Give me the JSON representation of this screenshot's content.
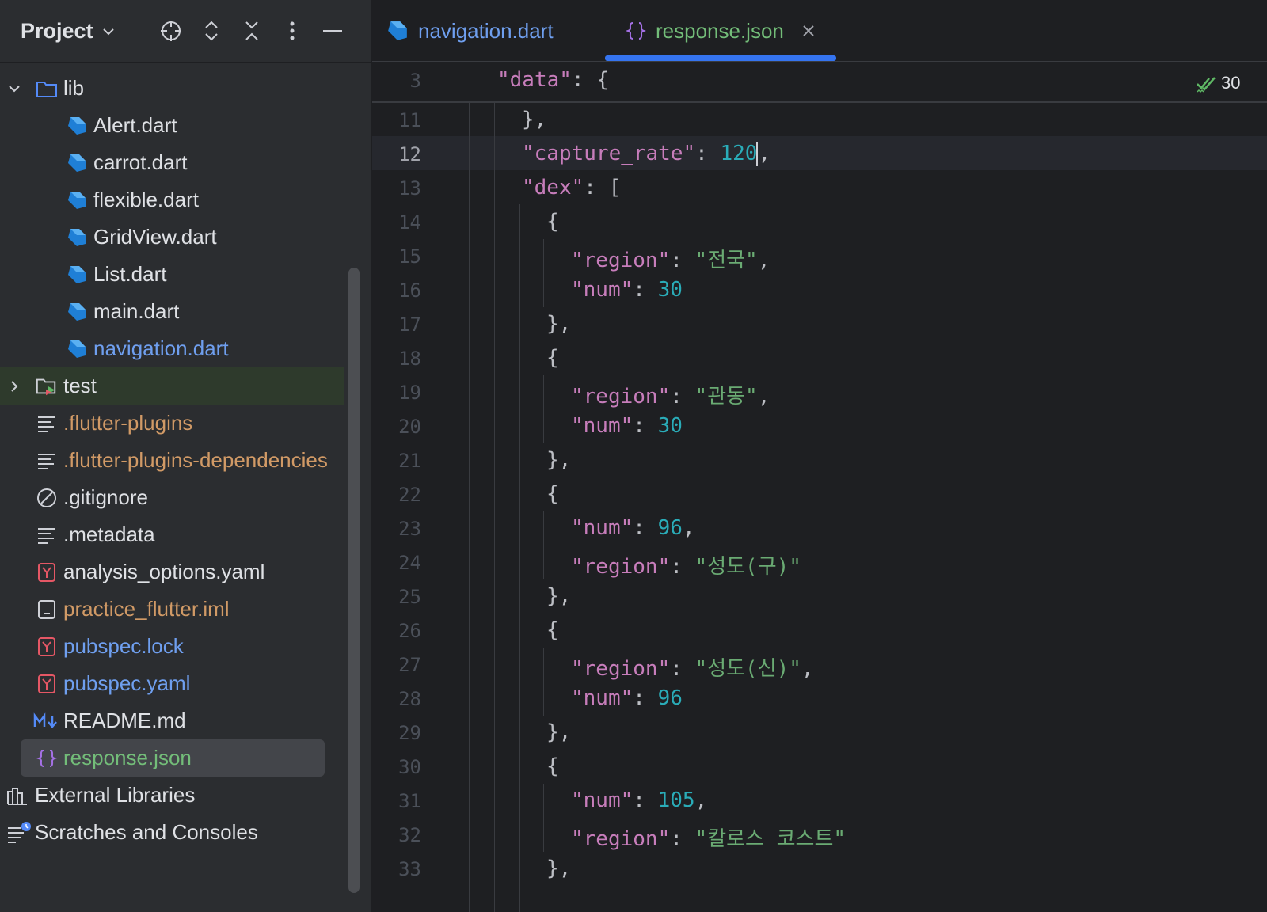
{
  "project_panel": {
    "title": "Project",
    "header_icons": [
      "locate-icon",
      "expand-all-icon",
      "collapse-all-icon",
      "more-options-icon",
      "hide-panel-icon"
    ],
    "tree": {
      "lib": "lib",
      "lib_files": [
        "Alert.dart",
        "carrot.dart",
        "flexible.dart",
        "GridView.dart",
        "List.dart",
        "main.dart",
        "navigation.dart"
      ],
      "test": "test",
      "root_files": [
        ".flutter-plugins",
        ".flutter-plugins-dependencies",
        ".gitignore",
        ".metadata",
        "analysis_options.yaml",
        "practice_flutter.iml",
        "pubspec.lock",
        "pubspec.yaml",
        "README.md",
        "response.json"
      ],
      "external_libraries": "External Libraries",
      "scratches": "Scratches and Consoles"
    }
  },
  "tabs": [
    {
      "label": "navigation.dart",
      "active": false
    },
    {
      "label": "response.json",
      "active": true
    }
  ],
  "editor": {
    "inspection_count": "30",
    "sticky": {
      "line": "3",
      "key": "\"data\"",
      "rest": ": {"
    },
    "lines": [
      {
        "num": "11",
        "current": false
      },
      {
        "num": "12",
        "current": true
      },
      {
        "num": "13",
        "current": false
      },
      {
        "num": "14",
        "current": false
      },
      {
        "num": "15",
        "current": false
      },
      {
        "num": "16",
        "current": false
      },
      {
        "num": "17",
        "current": false
      },
      {
        "num": "18",
        "current": false
      },
      {
        "num": "19",
        "current": false
      },
      {
        "num": "20",
        "current": false
      },
      {
        "num": "21",
        "current": false
      },
      {
        "num": "22",
        "current": false
      },
      {
        "num": "23",
        "current": false
      },
      {
        "num": "24",
        "current": false
      },
      {
        "num": "25",
        "current": false
      },
      {
        "num": "26",
        "current": false
      },
      {
        "num": "27",
        "current": false
      },
      {
        "num": "28",
        "current": false
      },
      {
        "num": "29",
        "current": false
      },
      {
        "num": "30",
        "current": false
      },
      {
        "num": "31",
        "current": false
      },
      {
        "num": "32",
        "current": false
      },
      {
        "num": "33",
        "current": false
      }
    ],
    "code": {
      "l11": "},",
      "l12_key": "\"capture_rate\"",
      "l12_val": "120",
      "l13_key": "\"dex\"",
      "l13_rest": ": [",
      "brace_open": "{",
      "brace_close": "},",
      "key_region": "\"region\"",
      "key_num": "\"num\"",
      "l15_val": "\"전국\"",
      "l16_val": "30",
      "l19_val": "\"관동\"",
      "l20_val": "30",
      "l23_val": "96",
      "l24_val": "\"성도(구)\"",
      "l27_val": "\"성도(신)\"",
      "l28_val": "96",
      "l31_val": "105",
      "l32_val": "\"칼로스 코스트\""
    }
  },
  "colors": {
    "accent": "#3574f0",
    "vcs_modified": "#6f9fef",
    "vcs_ignored": "#d19a66",
    "vcs_added": "#73bd79",
    "json_key": "#c77dbb",
    "json_string": "#6aab73",
    "json_number": "#2aacb8"
  }
}
